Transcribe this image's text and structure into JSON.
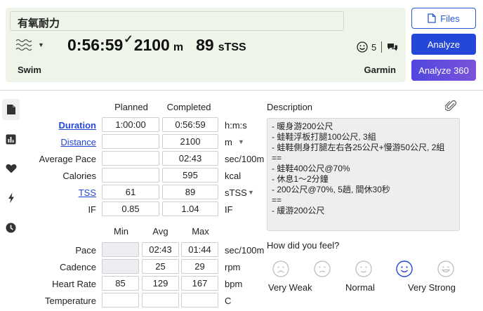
{
  "header": {
    "title": "有氧耐力",
    "duration": "0:56:59",
    "distance": "2100",
    "distance_unit": "m",
    "stss": "89",
    "stss_unit": "sTSS",
    "feel_count": "5",
    "sport": "Swim",
    "device": "Garmin"
  },
  "buttons": {
    "files": "Files",
    "analyze": "Analyze",
    "analyze360": "Analyze 360"
  },
  "table": {
    "planned_header": "Planned",
    "completed_header": "Completed",
    "rows": [
      {
        "label": "Duration",
        "planned": "1:00:00",
        "completed": "0:56:59",
        "unit": "h:m:s"
      },
      {
        "label": "Distance",
        "planned": "",
        "completed": "2100",
        "unit": "m"
      },
      {
        "label": "Average Pace",
        "planned": "",
        "completed": "02:43",
        "unit": "sec/100m"
      },
      {
        "label": "Calories",
        "planned": "",
        "completed": "595",
        "unit": "kcal"
      },
      {
        "label": "TSS",
        "planned": "61",
        "completed": "89",
        "unit": "sTSS"
      },
      {
        "label": "IF",
        "planned": "0.85",
        "completed": "1.04",
        "unit": "IF"
      }
    ]
  },
  "minmax": {
    "min_header": "Min",
    "avg_header": "Avg",
    "max_header": "Max",
    "rows": [
      {
        "label": "Pace",
        "min": "",
        "avg": "02:43",
        "max": "01:44",
        "unit": "sec/100m"
      },
      {
        "label": "Cadence",
        "min": "",
        "avg": "25",
        "max": "29",
        "unit": "rpm"
      },
      {
        "label": "Heart Rate",
        "min": "85",
        "avg": "129",
        "max": "167",
        "unit": "bpm"
      },
      {
        "label": "Temperature",
        "min": "",
        "avg": "",
        "max": "",
        "unit": "C"
      }
    ]
  },
  "description": {
    "label": "Description",
    "lines": [
      "- 暖身游200公尺",
      "- 蛙鞋浮板打腿100公尺, 3組",
      "- 蛙鞋側身打腿左右各25公尺+慢游50公尺, 2組",
      "==",
      "- 蛙鞋400公尺@70%",
      "- 休息1～2分鐘",
      "- 200公尺@70%, 5趟, 間休30秒",
      "==",
      "- 緩游200公尺"
    ]
  },
  "feel": {
    "question": "How did you feel?",
    "labels": [
      "Very Weak",
      "Normal",
      "Very Strong"
    ],
    "selected_index": 3,
    "accent": "#2547d8"
  }
}
